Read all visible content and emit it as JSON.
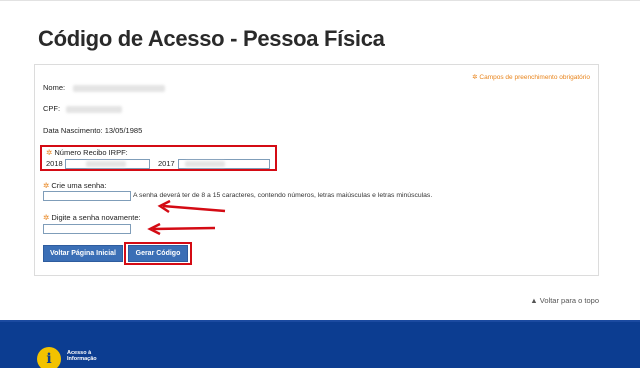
{
  "page": {
    "title": "Código de Acesso - Pessoa Física"
  },
  "form": {
    "required_note": "✲ Campos de preenchimento obrigatório",
    "nome_label": "Nome:",
    "cpf_label": "CPF:",
    "nascimento_label": "Data Nascimento:",
    "nascimento_value": "13/05/1985",
    "recibo_label": "Número Recibo IRPF:",
    "recibo_year_1": "2018",
    "recibo_year_2": "2017",
    "senha_label": "Crie uma senha:",
    "senha_hint": "A senha deverá ter de 8 a 15 caracteres, contendo números, letras maiúsculas e letras minúsculas.",
    "senha2_label": "Digite a senha novamente:",
    "required_star": "✲"
  },
  "buttons": {
    "back": "Voltar Página Inicial",
    "generate": "Gerar Código"
  },
  "nav": {
    "back_to_top": "▲ Voltar para o topo"
  },
  "footer": {
    "info_icon_glyph": "i",
    "info_line1": "Acesso à",
    "info_line2": "Informação"
  },
  "colors": {
    "highlight_red": "#d40b14",
    "required_orange": "#e8831a",
    "button_blue": "#3b6fb6",
    "footer_blue": "#0c3d91",
    "info_yellow": "#f2c200"
  }
}
